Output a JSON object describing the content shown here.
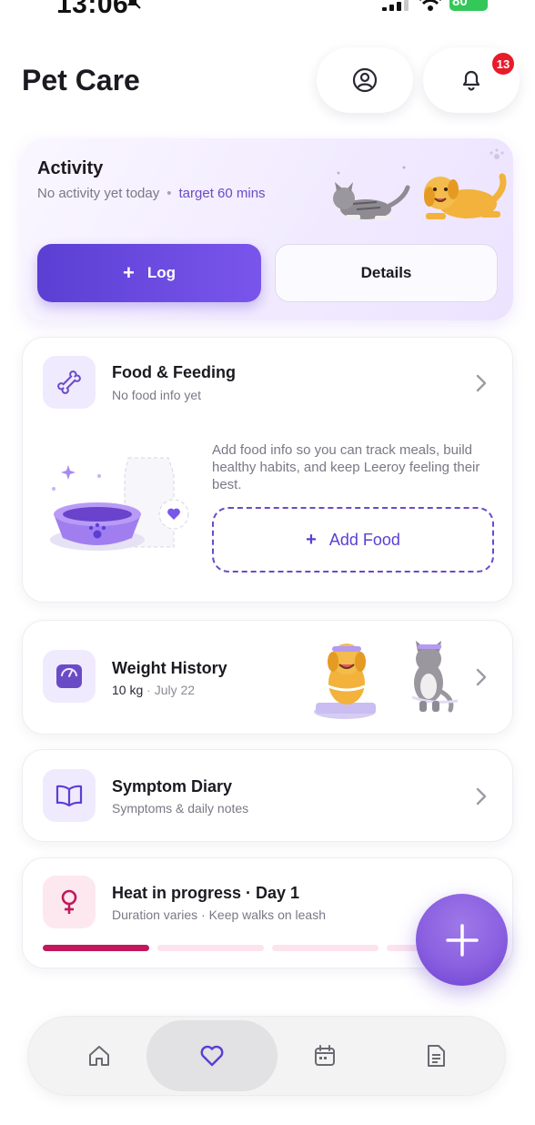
{
  "status_bar": {
    "time": "13:06",
    "battery": "80"
  },
  "header": {
    "title": "Pet Care",
    "notification_count": "13",
    "icons": {
      "profile": "user-circle-icon",
      "notifications": "bell-icon"
    }
  },
  "activity": {
    "title": "Activity",
    "subtitle": "No activity yet today",
    "separator": "•",
    "target": "target 60 mins",
    "log_button": {
      "icon": "+",
      "label": "Log"
    },
    "details_button": {
      "label": "Details"
    }
  },
  "food": {
    "title": "Food & Feeding",
    "subtitle": "No food info yet",
    "description": "Add food info so you can track meals, build healthy habits, and keep Leeroy feeling their best.",
    "add_button": {
      "icon": "+",
      "label": "Add Food"
    },
    "icon": "bone-icon"
  },
  "weight": {
    "title": "Weight History",
    "value": "10 kg",
    "separator": "·",
    "date": "July 22",
    "icon": "scale-icon"
  },
  "symptom": {
    "title": "Symptom Diary",
    "subtitle": "Symptoms & daily notes",
    "icon": "book-icon"
  },
  "heat": {
    "title": "Heat in progress · Day 1",
    "subtitle": "Duration varies · Keep walks on leash",
    "icon": "female-symbol-icon",
    "progress": {
      "segments": 4,
      "completed": 1
    }
  },
  "colors": {
    "accent": "#5b3fd3",
    "accent_light": "#efeafd",
    "heat": "#c2185b",
    "badge": "#e81b2b"
  },
  "bottom_nav": {
    "items": [
      {
        "name": "home",
        "icon": "home-icon",
        "active": false
      },
      {
        "name": "health",
        "icon": "heart-icon",
        "active": true
      },
      {
        "name": "calendar",
        "icon": "calendar-icon",
        "active": false
      },
      {
        "name": "records",
        "icon": "document-icon",
        "active": false
      }
    ]
  }
}
